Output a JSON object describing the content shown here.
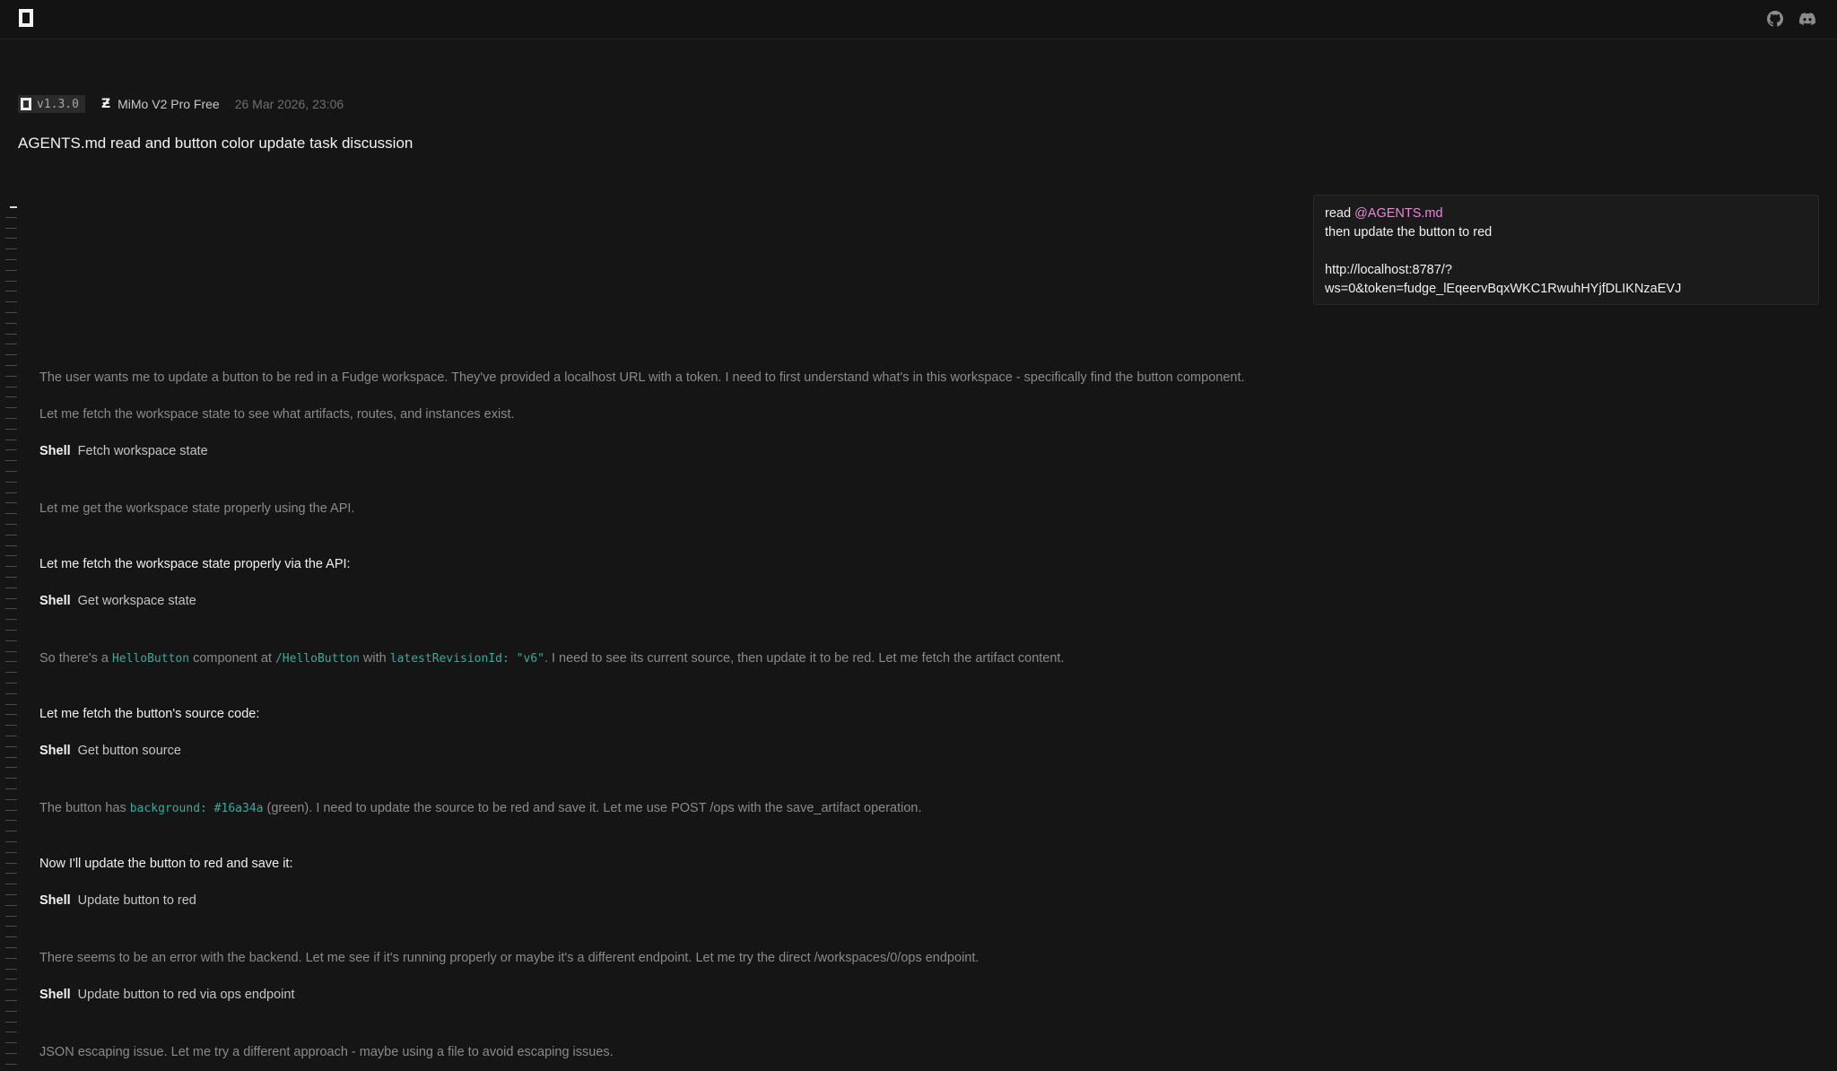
{
  "topbar": {
    "logo_icon": "opencode-logo-icon",
    "github_icon": "github-icon",
    "discord_icon": "discord-icon"
  },
  "session": {
    "version": "v1.3.0",
    "model_icon": "mimo-model-icon",
    "model": "MiMo V2 Pro Free",
    "timestamp": "26 Mar 2026, 23:06",
    "title": "AGENTS.md read and button color update task discussion"
  },
  "user_message": {
    "line1_prefix": "read ",
    "mention": "@AGENTS.md",
    "line2": "then update the button to red",
    "url_line1": "http://localhost:8787/?",
    "url_line2": "ws=0&token=fudge_lEqeervBqxWKC1RwuhHYjfDLIKNzaEVJ"
  },
  "transcript": {
    "r1": "The user wants me to update a button to be red in a Fudge workspace. They've provided a localhost URL with a token. I need to first understand what's in this workspace - specifically find the button component.",
    "r2": "Let me fetch the workspace state to see what artifacts, routes, and instances exist.",
    "t1_name": "Shell",
    "t1_desc": "Fetch workspace state",
    "r3": "Let me get the workspace state properly using the API.",
    "a1": "Let me fetch the workspace state properly via the API:",
    "t2_name": "Shell",
    "t2_desc": "Get workspace state",
    "r4_p1": "So there's a ",
    "r4_c1": "HelloButton",
    "r4_p2": " component at ",
    "r4_c2": "/HelloButton",
    "r4_p3": " with ",
    "r4_c3": "latestRevisionId: \"v6\"",
    "r4_p4": ". I need to see its current source, then update it to be red. Let me fetch the artifact content.",
    "a2": "Let me fetch the button's source code:",
    "t3_name": "Shell",
    "t3_desc": "Get button source",
    "r5_p1": "The button has ",
    "r5_c1": "background: #16a34a",
    "r5_p2": " (green). I need to update the source to be red and save it. Let me use POST /ops with the save_artifact operation.",
    "a3": "Now I'll update the button to red and save it:",
    "t4_name": "Shell",
    "t4_desc": "Update button to red",
    "r6": "There seems to be an error with the backend. Let me see if it's running properly or maybe it's a different endpoint. Let me try the direct /workspaces/0/ops endpoint.",
    "t5_name": "Shell",
    "t5_desc": "Update button to red via ops endpoint",
    "r7": "JSON escaping issue. Let me try a different approach - maybe using a file to avoid escaping issues."
  }
}
